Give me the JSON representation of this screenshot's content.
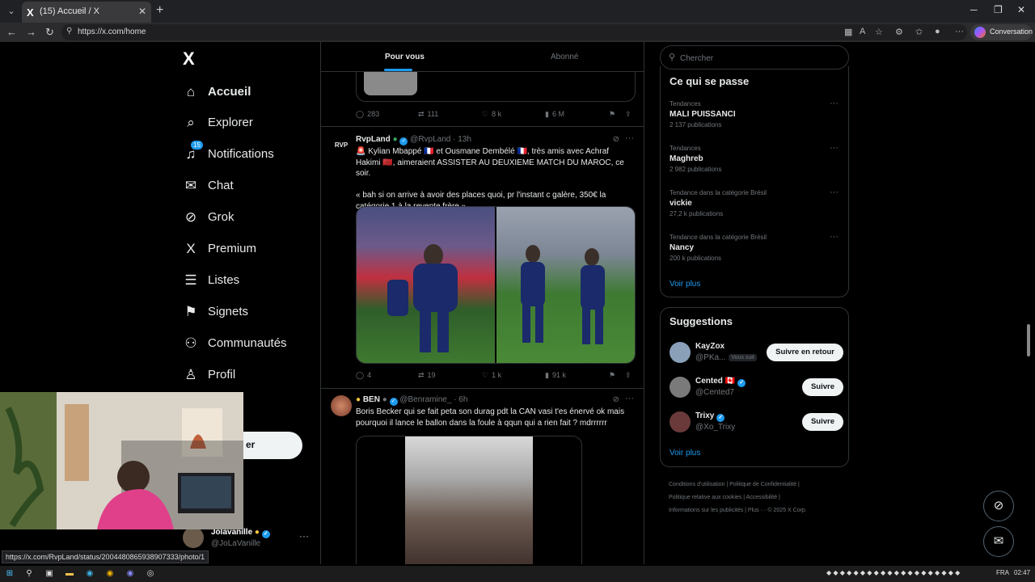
{
  "browser": {
    "tab_title": "(15) Accueil / X",
    "tab_favicon": "X",
    "url": "https://x.com/home",
    "copilot_label": "Conversation"
  },
  "sidebar": {
    "logo": "X",
    "items": [
      {
        "label": "Accueil",
        "icon": "home-icon",
        "glyph": "⌂"
      },
      {
        "label": "Explorer",
        "icon": "search-icon",
        "glyph": "⌕"
      },
      {
        "label": "Notifications",
        "icon": "bell-icon",
        "glyph": "♫"
      },
      {
        "label": "Chat",
        "icon": "mail-icon",
        "glyph": "✉"
      },
      {
        "label": "Grok",
        "icon": "grok-icon",
        "glyph": "⊘"
      },
      {
        "label": "Premium",
        "icon": "x-premium-icon",
        "glyph": "X"
      },
      {
        "label": "Listes",
        "icon": "list-icon",
        "glyph": "☰"
      },
      {
        "label": "Signets",
        "icon": "bookmark-icon",
        "glyph": "⚑"
      },
      {
        "label": "Communautés",
        "icon": "communities-icon",
        "glyph": "⚇"
      },
      {
        "label": "Profil",
        "icon": "profile-icon",
        "glyph": "♙"
      }
    ],
    "notif_count": "15",
    "post_label": "er",
    "account": {
      "name": "Jolavanille",
      "handle": "@JoLaVanille"
    }
  },
  "feed": {
    "tabs": [
      "Pour vous",
      "Abonné"
    ],
    "prev_actions": {
      "replies": "283",
      "reposts": "111",
      "likes": "8 k",
      "views": "6 M"
    },
    "tweet1": {
      "name": "RvpLand",
      "handle": "@RvpLand · 13h",
      "avatar_text": "RVP",
      "text": "🚨 Kylian Mbappé 🇫🇷 et Ousmane Dembélé 🇫🇷, très amis avec Achraf Hakimi 🇲🇦, aimeraient ASSISTER AU DEUXIEME MATCH DU MAROC, ce soir.\n\n« bah si on arrive à avoir des places quoi, pr l'instant c galère, 350€ la catégorie 1 à la revente frère »",
      "actions": {
        "replies": "4",
        "reposts": "19",
        "likes": "1 k",
        "views": "91 k"
      }
    },
    "tweet2": {
      "name": "BEN",
      "handle": "@Benramine_ · 6h",
      "text": "Boris Becker qui se fait peta son durag pdt la CAN vasi t'es énervé ok mais pourquoi il lance le ballon dans la foule à qqun qui a rien fait ? mdrrrrrr"
    }
  },
  "right": {
    "search_placeholder": "Chercher",
    "trends_title": "Ce qui se passe",
    "trends": [
      {
        "category": "Tendances",
        "name": "MALI PUISSANCI",
        "count": "2 137 publications"
      },
      {
        "category": "Tendances",
        "name": "Maghreb",
        "count": "2 982 publications"
      },
      {
        "category": "Tendance dans la catégorie Brésil",
        "name": "vickie",
        "count": "27,2 k publications"
      },
      {
        "category": "Tendance dans la catégorie Brésil",
        "name": "Nancy",
        "count": "200 k publications"
      }
    ],
    "voir_plus": "Voir plus",
    "suggestions_title": "Suggestions",
    "suggestions": [
      {
        "name": "KayZox",
        "handle": "@PKa...",
        "follows_you": "Vous suit",
        "button": "Suivre en retour"
      },
      {
        "name": "Cented 🇨🇦",
        "handle": "@Cented7",
        "follows_you": "",
        "button": "Suivre"
      },
      {
        "name": "Trixy",
        "handle": "@Xo_Trixy",
        "follows_you": "",
        "button": "Suivre"
      }
    ],
    "footer": {
      "line1": "Conditions d'utilisation  |  Politique de Confidentialité  |",
      "line2": "Politique relative aux cookies  |  Accessibilité  |",
      "line3": "Informations sur les publicités  |  Plus ···  © 2025 X Corp."
    }
  },
  "status_url": "https://x.com/RvpLand/status/2004480865938907333/photo/1",
  "taskbar": {
    "lang": "FRA",
    "time": "02:47"
  }
}
